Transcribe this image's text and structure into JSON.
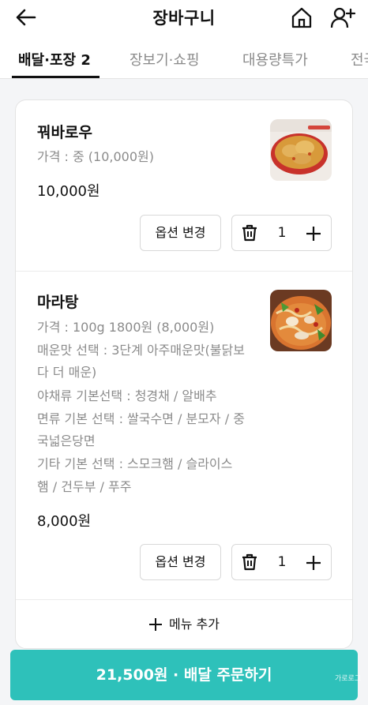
{
  "header": {
    "title": "장바구니",
    "icons": [
      "back-arrow-icon",
      "home-icon",
      "add-user-icon"
    ]
  },
  "tabs": [
    {
      "label": "배달·포장 2",
      "active": true
    },
    {
      "label": "장보기·쇼핑",
      "active": false
    },
    {
      "label": "대용량특가",
      "active": false
    },
    {
      "label": "전국",
      "active": false
    }
  ],
  "items": [
    {
      "name": "꿔바로우",
      "options": [
        "가격 : 중 (10,000원)"
      ],
      "price": "10,000원",
      "option_button": "옵션 변경",
      "quantity": "1"
    },
    {
      "name": "마라탕",
      "options": [
        "가격 : 100g 1800원 (8,000원)",
        "매운맛 선택 : 3단계 아주매운맛(불닭보",
        "다 더 매운)",
        "야채류 기본선택 : 청경채 / 알배추",
        "면류 기본 선택 : 쌀국수면 / 분모자 / 중",
        "국넓은당면",
        "기타 기본 선택 : 스모크햄 / 슬라이스",
        "햄 / 건두부 / 푸주"
      ],
      "price": "8,000원",
      "option_button": "옵션 변경",
      "quantity": "1"
    }
  ],
  "add_menu": {
    "label": "메뉴 추가"
  },
  "order_button": {
    "label": "21,500원 · 배달 주문하기"
  },
  "watermark": {
    "text": "가로로그"
  },
  "colors": {
    "accent": "#2ec1ba",
    "muted_text": "#8b8b8b"
  }
}
